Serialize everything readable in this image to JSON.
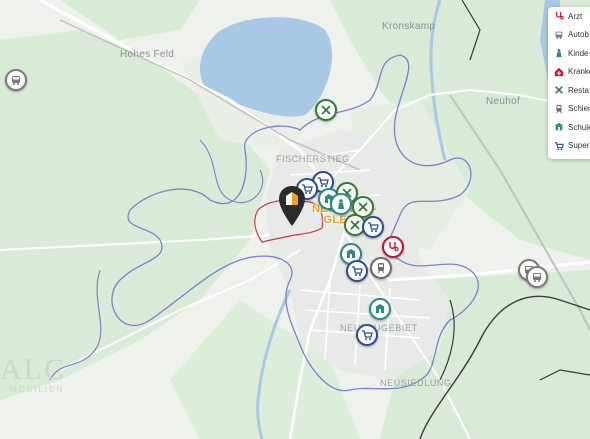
{
  "map": {
    "place_labels": {
      "hohes_feld": "Hohes Feld",
      "kronskamp": "Kronskamp",
      "neuhof": "Neuhof",
      "fischerstieg": "FISCHERSTIEG",
      "neubaugebiet": "NEUBAUGEBIET",
      "neusiedlung": "NEUSIEDLUNG"
    },
    "town": {
      "line1": "NEUSTADT-",
      "line2": "GLEWE"
    },
    "watermark": {
      "text": "ALC",
      "subtext": "MOBILIEN"
    },
    "colors": {
      "water": "#a9c8e6",
      "forest": "#d9ead6",
      "boundary": "#7f7fd1",
      "property_outline": "#d03a4a",
      "town_label": "#f2a11c"
    }
  },
  "legend": {
    "items": [
      {
        "label": "Arzt",
        "icon": "stethoscope-icon",
        "color": "#c8102e"
      },
      {
        "label": "Autob",
        "icon": "bus-icon",
        "color": "#7a7a7a"
      },
      {
        "label": "Kinde",
        "icon": "kindergarten-icon",
        "color": "#2a8a8a"
      },
      {
        "label": "Kranke",
        "icon": "hospital-icon",
        "color": "#c8102e"
      },
      {
        "label": "Resta",
        "icon": "restaurant-icon",
        "color": "#2e7d32"
      },
      {
        "label": "Schien",
        "icon": "train-icon",
        "color": "#6a6a6a"
      },
      {
        "label": "Schule",
        "icon": "school-icon",
        "color": "#2a8a8a"
      },
      {
        "label": "Super",
        "icon": "cart-icon",
        "color": "#2c4a9b"
      }
    ]
  }
}
